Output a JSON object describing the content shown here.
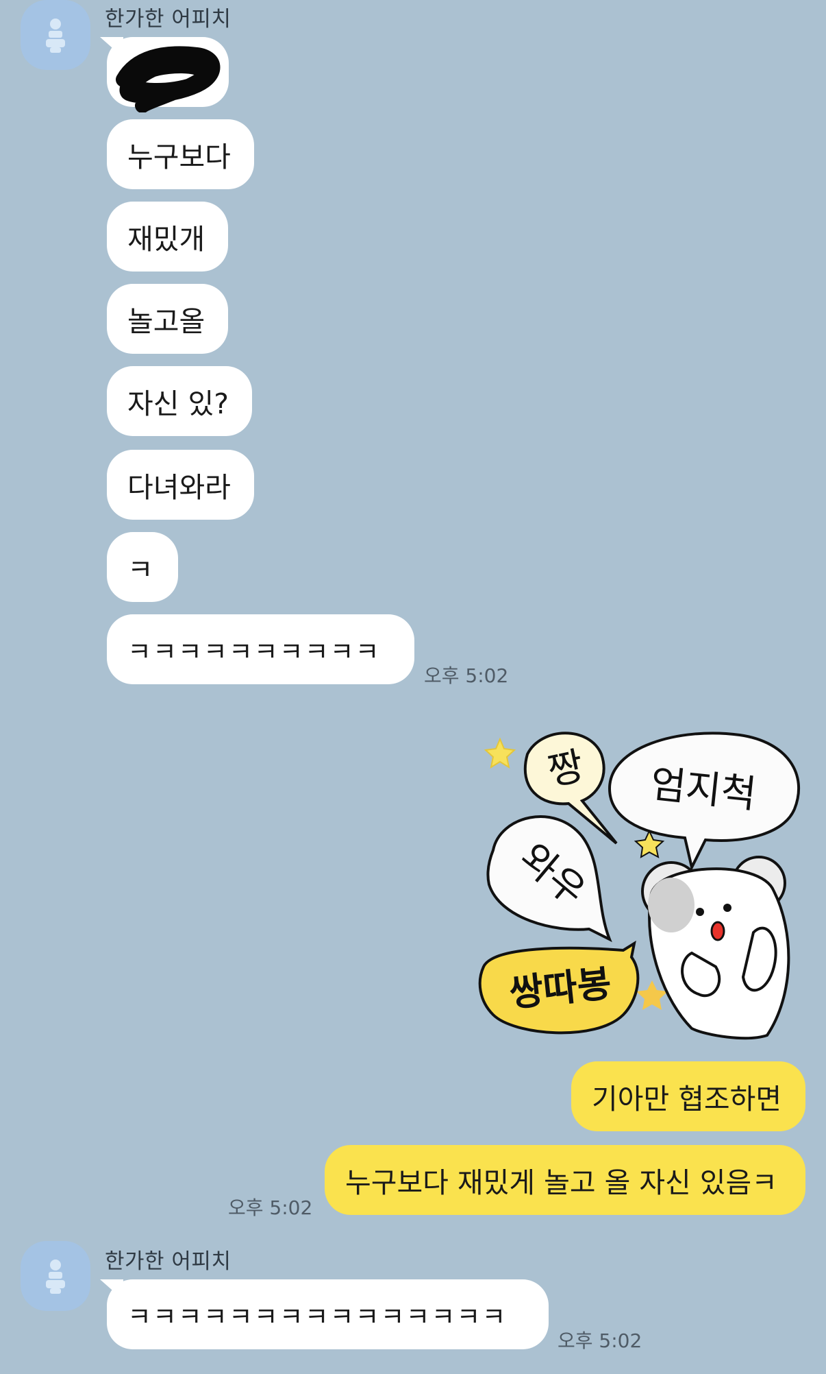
{
  "chat": {
    "messages_group1": {
      "sender": "한가한 어피치",
      "bubbles": [
        "누구보다",
        "재밌개",
        "놀고올",
        "자신 있?",
        "다녀와라",
        "ㅋ",
        "ㅋㅋㅋㅋㅋㅋㅋㅋㅋㅋ"
      ],
      "time": "오후 5:02"
    },
    "my_messages": {
      "sticker": "sticker-thumbs-up",
      "sticker_text": [
        "짱",
        "엄지척",
        "와우",
        "쌍따봉"
      ],
      "bubbles": [
        "기아만 협조하면",
        "누구보다 재밌게 놀고 올 자신 있음ㅋ"
      ],
      "time": "오후 5:02"
    },
    "messages_group2": {
      "sender": "한가한 어피치",
      "bubbles": [
        "ㅋㅋㅋㅋㅋㅋㅋㅋㅋㅋㅋㅋㅋㅋㅋ"
      ],
      "time": "오후 5:02"
    }
  },
  "colors": {
    "background": "#abc1d1",
    "my_bubble": "#fae24e",
    "their_bubble": "#ffffff",
    "avatar": "#a4c3e4"
  }
}
